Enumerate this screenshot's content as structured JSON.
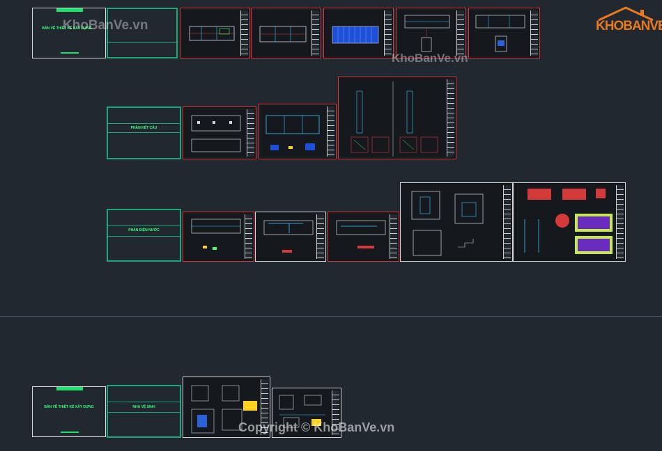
{
  "watermarks": {
    "top_left": "KhoBanVe.vn",
    "top_mid": "KhoBanVe.vn",
    "bottom": "Copyright © KhoBanVe.vn"
  },
  "logo": {
    "text": "KHOBANVE",
    "house": "house-roof",
    "color": "#e8791d"
  },
  "row1": {
    "cover_title": "BẢN VẼ THIẾT KẾ XÂY DỰNG"
  },
  "row2": {
    "section_title": "PHẦN KẾT CẤU"
  },
  "row3": {
    "section_title": "PHẦN ĐIỆN NƯỚC"
  },
  "row4": {
    "cover_title": "BẢN VẼ THIẾT KẾ XÂY DỰNG",
    "section_title": "NHÀ VỆ SINH"
  },
  "colors": {
    "background": "#212830",
    "frame_white": "#d8d8d8",
    "frame_green": "#1fa57a",
    "frame_red": "#d43a3a",
    "title_green": "#37ff7a"
  }
}
